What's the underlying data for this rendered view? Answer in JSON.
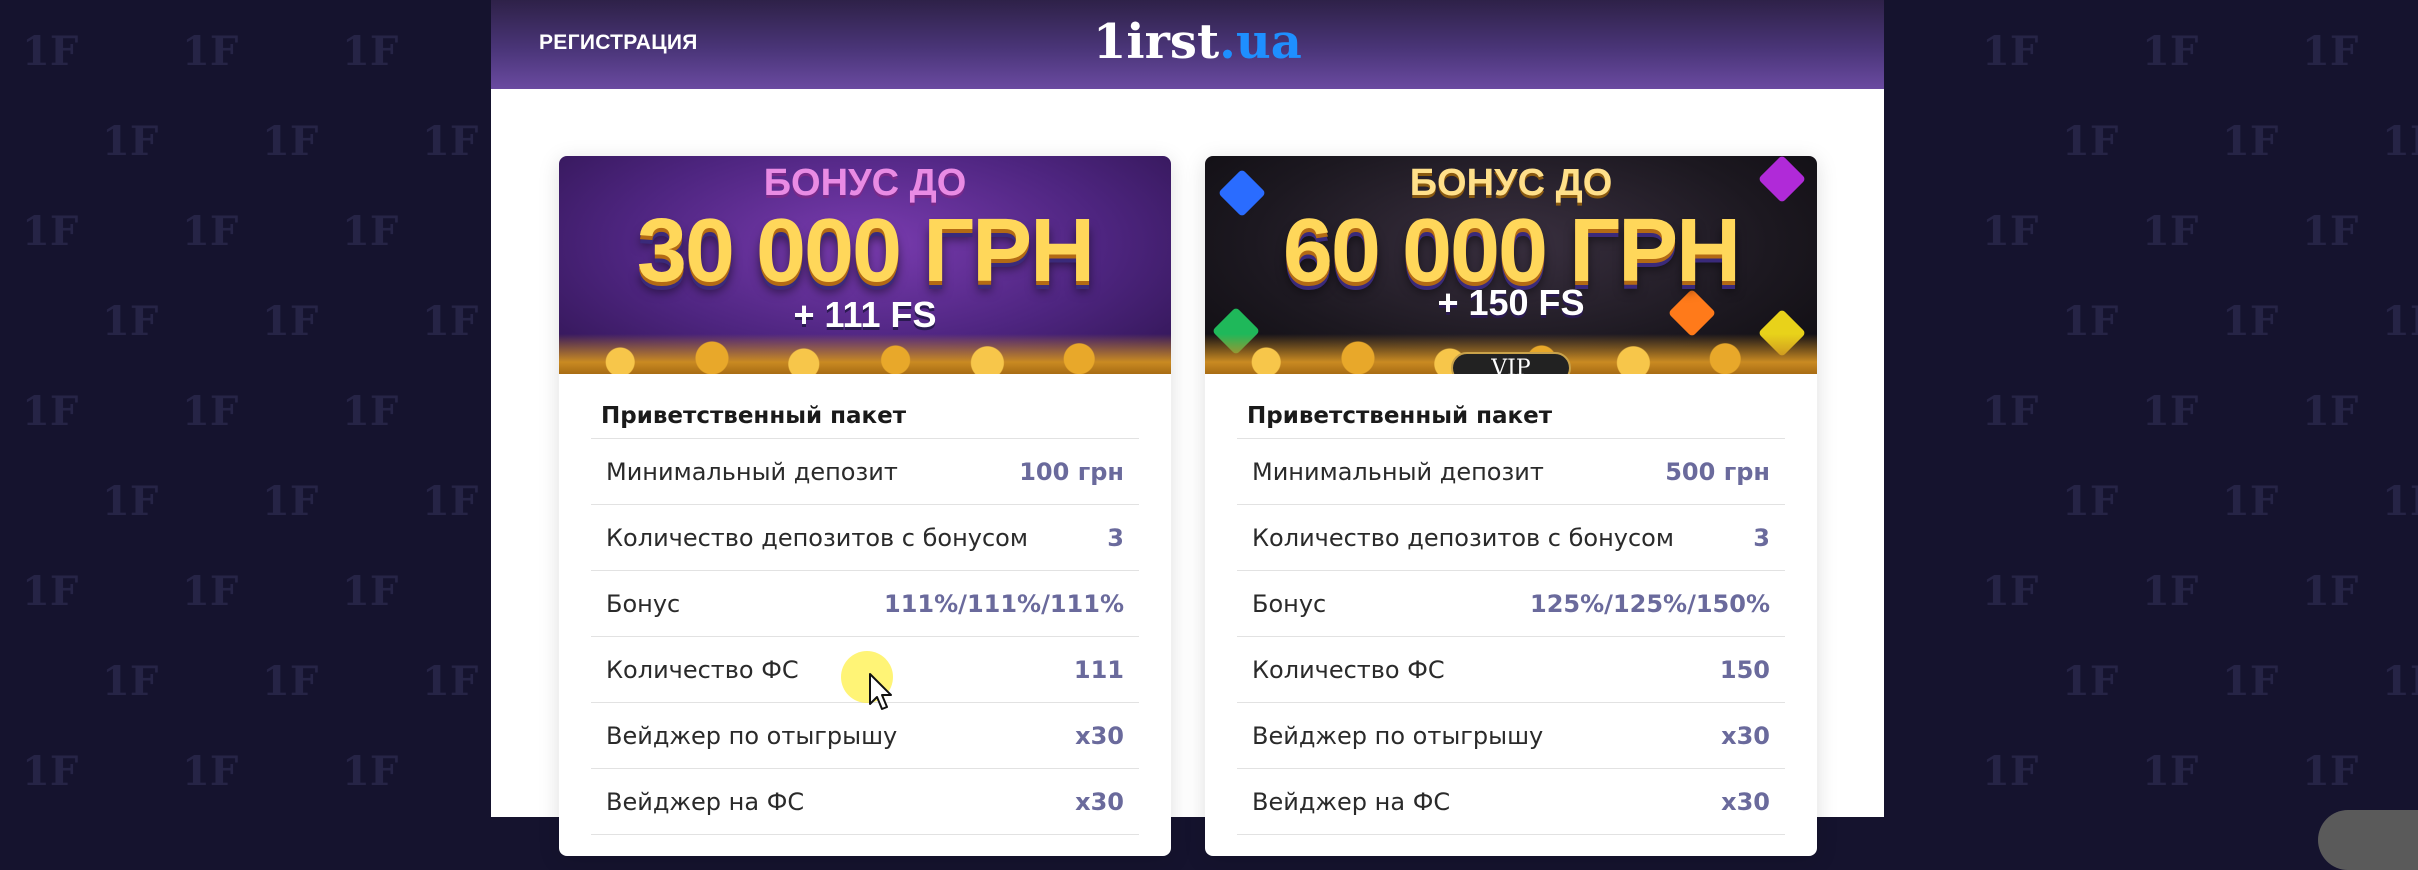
{
  "header": {
    "register_label": "РЕГИСТРАЦИЯ",
    "logo_white": "1irst",
    "logo_blue": ".ua"
  },
  "background_logo_glyph": "1F",
  "offers": [
    {
      "banner": {
        "top": "БОНУС ДО",
        "amount": "30 000 ГРН",
        "fs": "+ 111 FS"
      },
      "title": "Приветственный пакет",
      "rows": [
        {
          "label": "Минимальный депозит",
          "value": "100 грн"
        },
        {
          "label": "Количество депозитов с бонусом",
          "value": "3"
        },
        {
          "label": "Бонус",
          "value": "111%/111%/111%"
        },
        {
          "label": "Количество ФС",
          "value": "111"
        },
        {
          "label": "Вейджер по отыгрышу",
          "value": "x30"
        },
        {
          "label": "Вейджер на ФС",
          "value": "x30"
        }
      ]
    },
    {
      "banner": {
        "top": "БОНУС ДО",
        "amount": "60 000 ГРН",
        "fs": "+ 150 FS",
        "badge": "VIP"
      },
      "title": "Приветственный пакет",
      "rows": [
        {
          "label": "Минимальный депозит",
          "value": "500 грн"
        },
        {
          "label": "Количество депозитов с бонусом",
          "value": "3"
        },
        {
          "label": "Бонус",
          "value": "125%/125%/150%"
        },
        {
          "label": "Количество ФС",
          "value": "150"
        },
        {
          "label": "Вейджер по отыгрышу",
          "value": "x30"
        },
        {
          "label": "Вейджер на ФС",
          "value": "x30"
        }
      ]
    }
  ],
  "colors": {
    "page_bg": "#15132e",
    "header_gradient_top": "#2e2148",
    "header_gradient_bottom": "#6a4aa0",
    "value_text": "#6a6a9c",
    "logo_accent": "#1e8fff"
  }
}
